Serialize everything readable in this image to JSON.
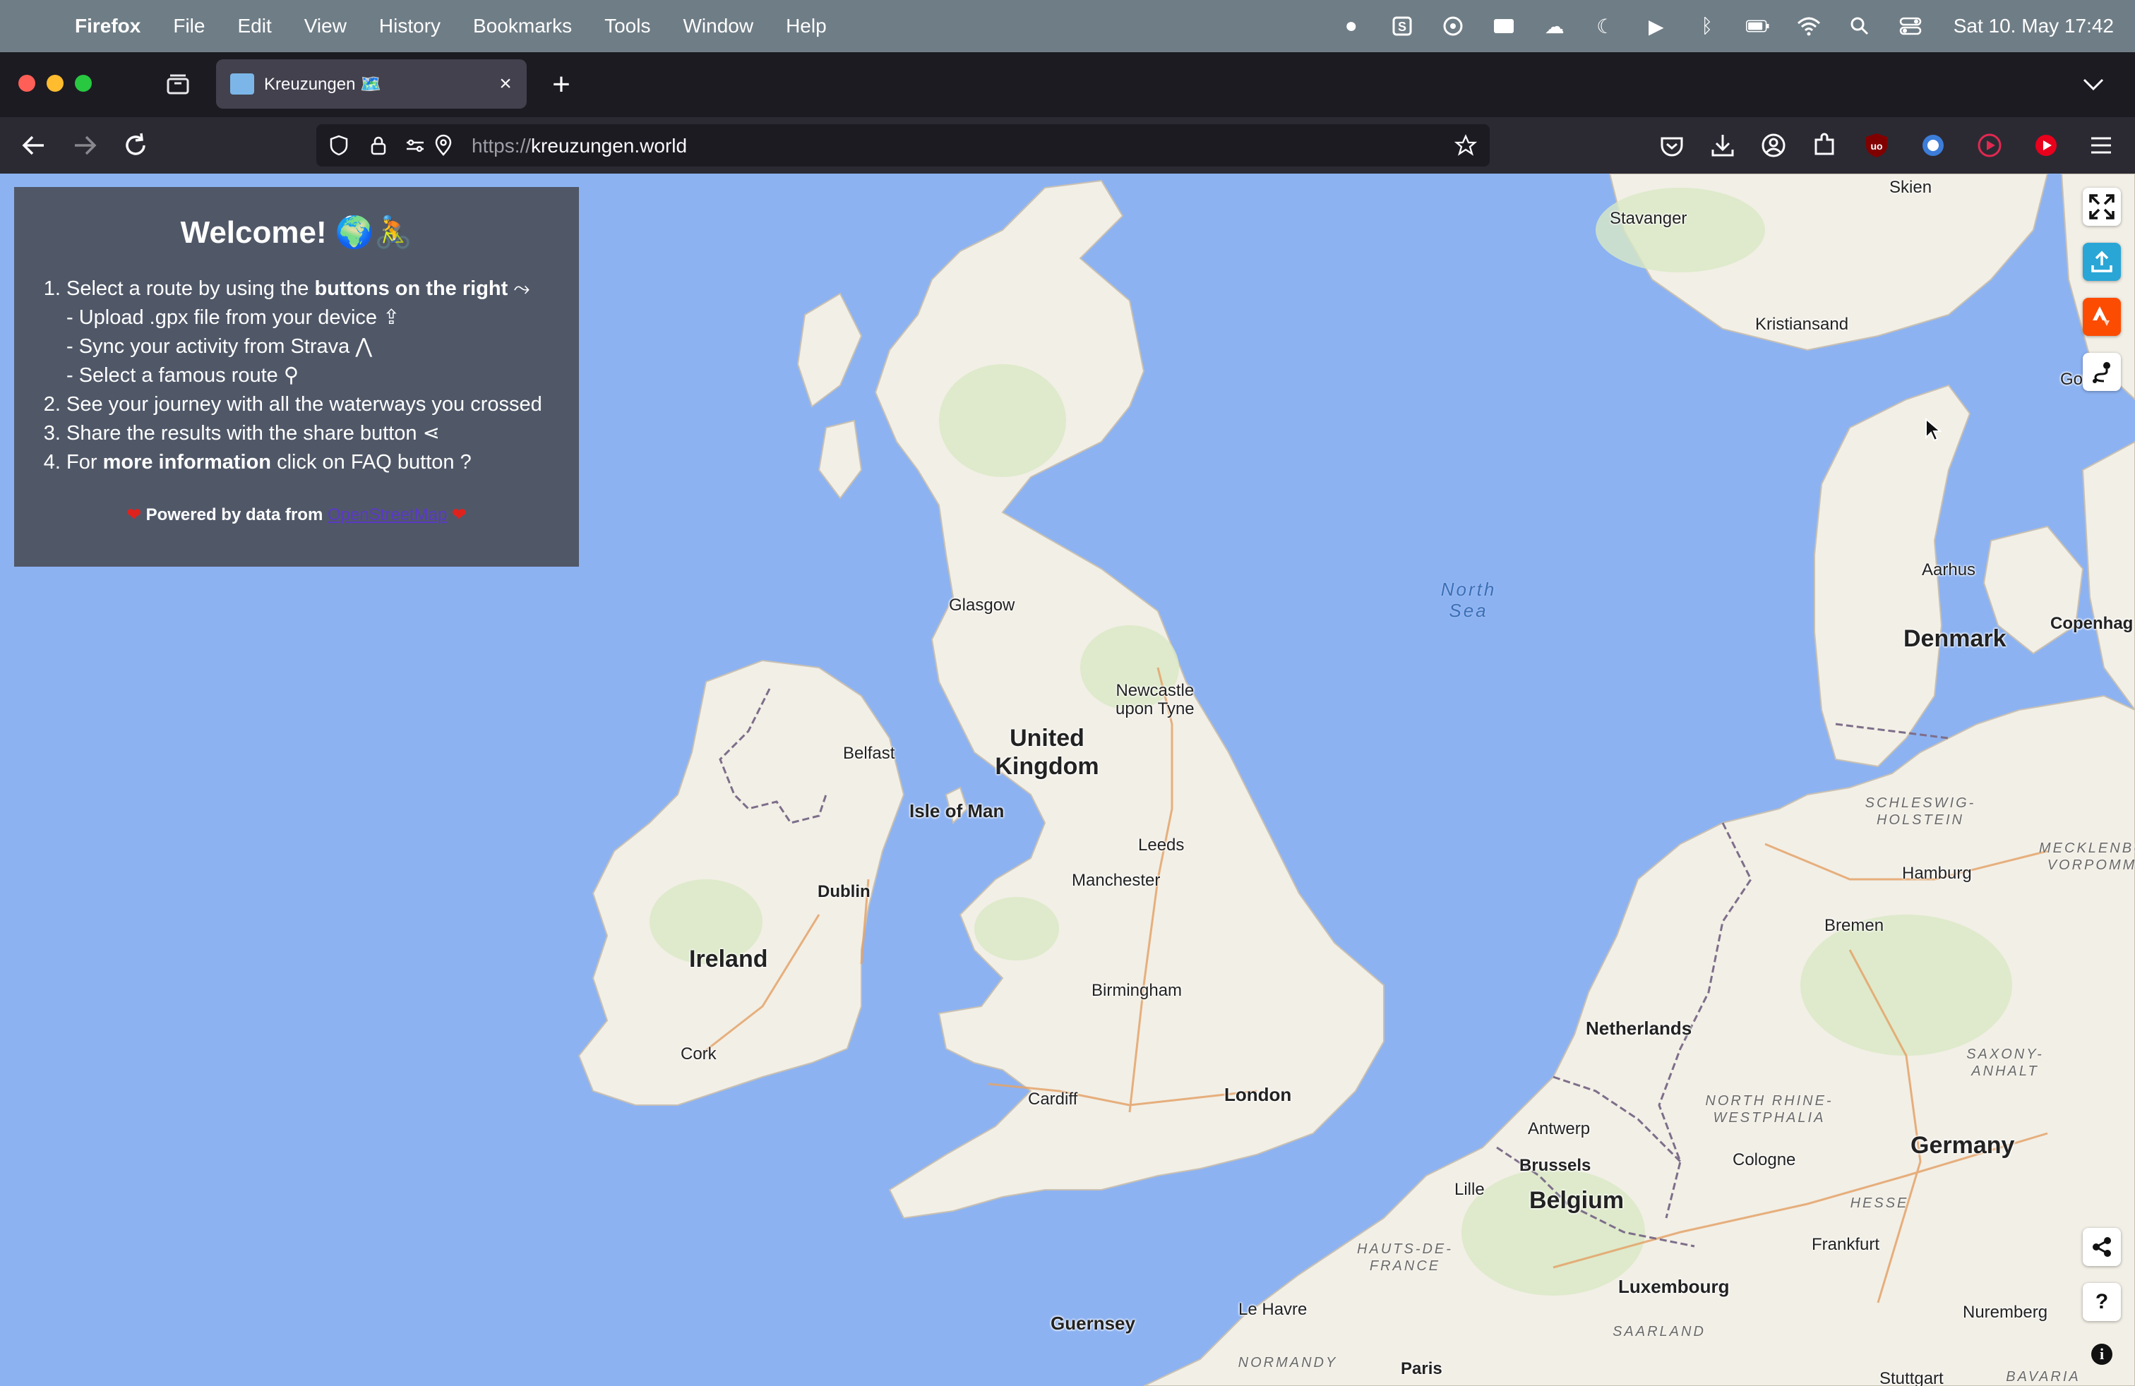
{
  "menubar": {
    "app": "Firefox",
    "items": [
      "File",
      "Edit",
      "View",
      "History",
      "Bookmarks",
      "Tools",
      "Window",
      "Help"
    ],
    "clock": "Sat 10. May  17:42"
  },
  "tab": {
    "title": "Kreuzungen 🗺️"
  },
  "url": {
    "scheme": "https://",
    "host": "kreuzungen.world"
  },
  "welcome": {
    "title": "Welcome! 🌍🚴",
    "step1_pre": "Select a route by using the ",
    "step1_bold": "buttons on the right",
    "step1_icon": "⤳",
    "sub1": "- Upload .gpx file from your device",
    "sub2": "- Sync your activity from Strava",
    "sub3": "- Select a famous route",
    "step2": "See your journey with all the waterways you crossed",
    "step3": "Share the results with the share button",
    "step4_pre": "For ",
    "step4_bold": "more information",
    "step4_post": " click on FAQ button ?",
    "powered_pre": "Powered by data from ",
    "powered_link": "OpenStreetMap"
  },
  "map": {
    "countries": [
      "United Kingdom",
      "Ireland",
      "Denmark",
      "Netherlands",
      "Belgium",
      "Germany",
      "Luxembourg"
    ],
    "islands": [
      "Isle of Man",
      "Guernsey"
    ],
    "sea": "North Sea",
    "cities": {
      "skien": "Skien",
      "stavanger": "Stavanger",
      "kristiansand": "Kristiansand",
      "gothenburg": "Gothenl",
      "aarhus": "Aarhus",
      "copenhagen": "Copenhag",
      "glasgow": "Glasgow",
      "newcastle": "Newcastle\nupon Tyne",
      "belfast": "Belfast",
      "dublin": "Dublin",
      "leeds": "Leeds",
      "manchester": "Manchester",
      "birmingham": "Birmingham",
      "cork": "Cork",
      "cardiff": "Cardiff",
      "london": "London",
      "hamburg": "Hamburg",
      "bremen": "Bremen",
      "antwerp": "Antwerp",
      "brussels": "Brussels",
      "lille": "Lille",
      "cologne": "Cologne",
      "frankfurt": "Frankfurt",
      "nuremberg": "Nuremberg",
      "lehavre": "Le Havre",
      "paris": "Paris",
      "stuttgart": "Stuttgart"
    },
    "regions": {
      "schleswig": "SCHLESWIG-\nHOLSTEIN",
      "mecklenburg": "MECKLENBU\nVORPOMM",
      "saxony": "SAXONY-\nANHALT",
      "nrw": "NORTH RHINE-\nWESTPHALIA",
      "hesse": "HESSE",
      "hauts": "HAUTS-DE-\nFRANCE",
      "saarland": "SAARLAND",
      "normandy": "NORMANDY",
      "bavaria": "BAVARIA"
    }
  },
  "controls": {
    "faq": "?",
    "info": "i"
  },
  "colors": {
    "water": "#8cb2f2",
    "land": "#f2efe6",
    "panel": "#505868",
    "upload": "#29a6d6",
    "strava": "#fc4c02"
  }
}
